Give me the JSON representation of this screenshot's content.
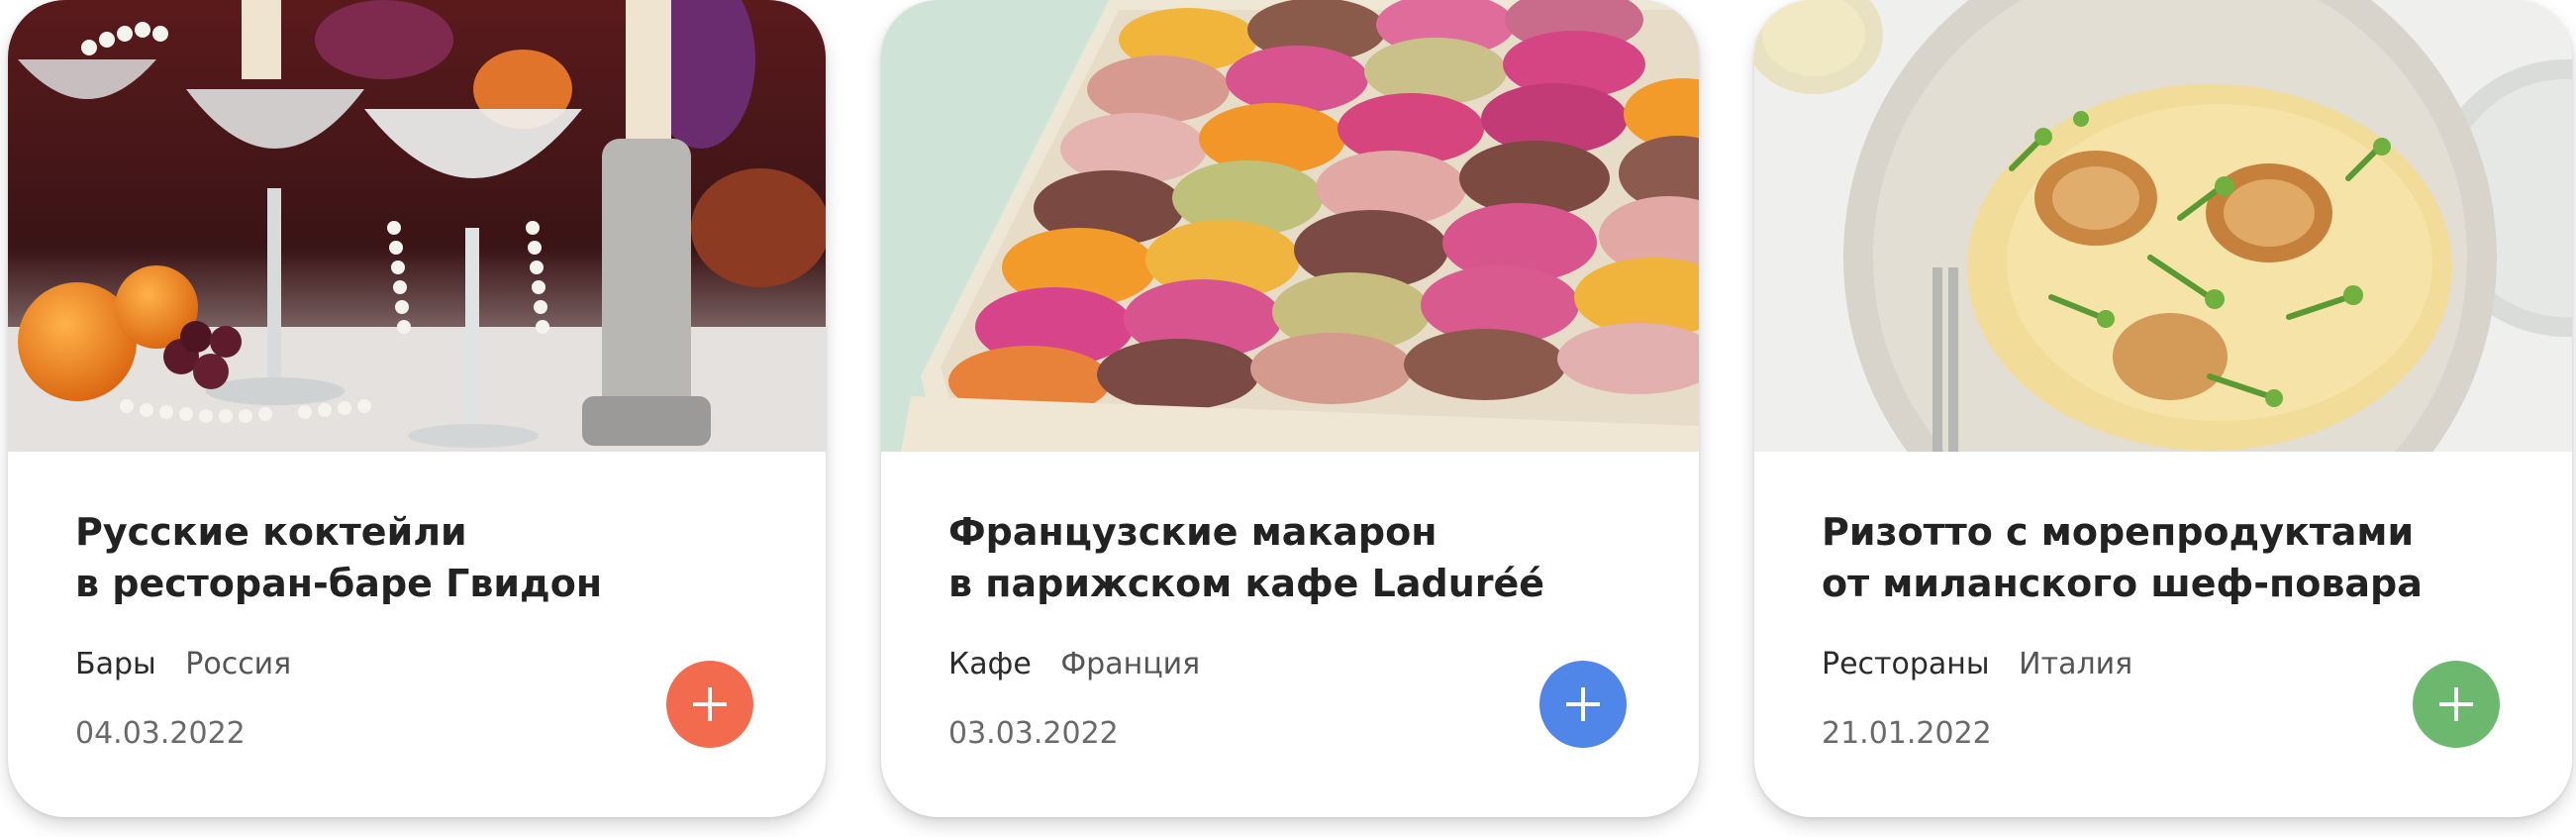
{
  "cards": [
    {
      "title_line1": "Русские коктейли",
      "title_line2": "в ресторан-баре Гвидон",
      "category": "Бары",
      "country": "Россия",
      "date": "04.03.2022",
      "accent": "#F26B4F",
      "photo": "champagne-coupes-with-pearls"
    },
    {
      "title_line1": "Французские макарон",
      "title_line2": "в парижском кафе Laduréé",
      "category": "Кафе",
      "country": "Франция",
      "date": "03.03.2022",
      "accent": "#4F86E8",
      "photo": "box-of-macarons"
    },
    {
      "title_line1": "Ризотто с морепродуктами",
      "title_line2": "от миланского шеф-повара",
      "category": "Рестораны",
      "country": "Италия",
      "date": "21.01.2022",
      "accent": "#6DB86F",
      "photo": "risotto-with-scallops"
    }
  ]
}
